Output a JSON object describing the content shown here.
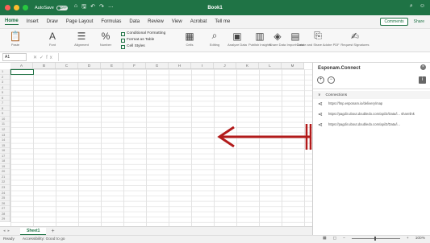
{
  "window": {
    "autosave_label": "AutoSave",
    "autosave_state": "OFF",
    "doc_title": "Book1",
    "quick_access": [
      "⌂",
      "🖫",
      "↶",
      "↷",
      "…"
    ]
  },
  "ribbon_tabs": [
    "Home",
    "Insert",
    "Draw",
    "Page Layout",
    "Formulas",
    "Data",
    "Review",
    "View",
    "Acrobat",
    "Tell me"
  ],
  "ribbon_buttons": {
    "comments": "Comments",
    "share": "Share"
  },
  "ribbon": {
    "paste": "Paste",
    "font": "Font",
    "alignment": "Alignment",
    "number": "Number",
    "conditional_formatting": "Conditional Formatting",
    "format_as_table": "Format as Table",
    "cell_styles": "Cell Styles",
    "cells": "Cells",
    "editing": "Editing",
    "analyze_data": "Analyze Data",
    "publish_insights": "Publish Insights",
    "share_data": "Share Data",
    "import_data": "Import Data",
    "create_share_adobe_pdf": "Create and Share Adobe PDF",
    "request_signatures": "Request Signatures"
  },
  "formula_bar": {
    "name_box": "A1",
    "fx": "fx",
    "value": ""
  },
  "columns": [
    "A",
    "B",
    "C",
    "D",
    "E",
    "F",
    "G",
    "H",
    "I",
    "J",
    "K",
    "L",
    "M"
  ],
  "rows": [
    "1",
    "2",
    "3",
    "4",
    "5",
    "6",
    "7",
    "8",
    "9",
    "10",
    "11",
    "12",
    "13",
    "14",
    "15",
    "16",
    "17",
    "18",
    "19",
    "20",
    "21",
    "22",
    "23",
    "24",
    "25",
    "26",
    "27",
    "28",
    "29"
  ],
  "sheet_tabs": {
    "active": "Sheet1",
    "add": "+"
  },
  "status": {
    "ready": "Ready",
    "accessibility": "Accessibility: Good to go",
    "zoom": "100%"
  },
  "task_pane": {
    "title": "Esponam.Connect",
    "close": "×",
    "connections_header": "Connections",
    "connections": [
      "https://fmp.esponam.io/delivery/map",
      "https://pagdir.ubout.doubledo.com/api/2/Data/i... sharelink",
      "https://pagdir.ubout.doubledo.com/api/2/Data/i..."
    ]
  },
  "colors": {
    "brand": "#1f7345",
    "arrow": "#b21a1a"
  },
  "annotation": {
    "type": "arrow",
    "direction": "left"
  }
}
